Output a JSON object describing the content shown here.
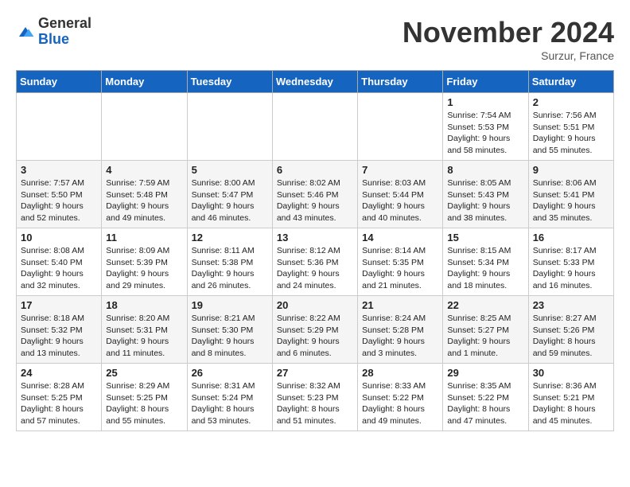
{
  "logo": {
    "general": "General",
    "blue": "Blue"
  },
  "title": "November 2024",
  "subtitle": "Surzur, France",
  "days_of_week": [
    "Sunday",
    "Monday",
    "Tuesday",
    "Wednesday",
    "Thursday",
    "Friday",
    "Saturday"
  ],
  "weeks": [
    [
      {
        "day": "",
        "info": ""
      },
      {
        "day": "",
        "info": ""
      },
      {
        "day": "",
        "info": ""
      },
      {
        "day": "",
        "info": ""
      },
      {
        "day": "",
        "info": ""
      },
      {
        "day": "1",
        "info": "Sunrise: 7:54 AM\nSunset: 5:53 PM\nDaylight: 9 hours and 58 minutes."
      },
      {
        "day": "2",
        "info": "Sunrise: 7:56 AM\nSunset: 5:51 PM\nDaylight: 9 hours and 55 minutes."
      }
    ],
    [
      {
        "day": "3",
        "info": "Sunrise: 7:57 AM\nSunset: 5:50 PM\nDaylight: 9 hours and 52 minutes."
      },
      {
        "day": "4",
        "info": "Sunrise: 7:59 AM\nSunset: 5:48 PM\nDaylight: 9 hours and 49 minutes."
      },
      {
        "day": "5",
        "info": "Sunrise: 8:00 AM\nSunset: 5:47 PM\nDaylight: 9 hours and 46 minutes."
      },
      {
        "day": "6",
        "info": "Sunrise: 8:02 AM\nSunset: 5:46 PM\nDaylight: 9 hours and 43 minutes."
      },
      {
        "day": "7",
        "info": "Sunrise: 8:03 AM\nSunset: 5:44 PM\nDaylight: 9 hours and 40 minutes."
      },
      {
        "day": "8",
        "info": "Sunrise: 8:05 AM\nSunset: 5:43 PM\nDaylight: 9 hours and 38 minutes."
      },
      {
        "day": "9",
        "info": "Sunrise: 8:06 AM\nSunset: 5:41 PM\nDaylight: 9 hours and 35 minutes."
      }
    ],
    [
      {
        "day": "10",
        "info": "Sunrise: 8:08 AM\nSunset: 5:40 PM\nDaylight: 9 hours and 32 minutes."
      },
      {
        "day": "11",
        "info": "Sunrise: 8:09 AM\nSunset: 5:39 PM\nDaylight: 9 hours and 29 minutes."
      },
      {
        "day": "12",
        "info": "Sunrise: 8:11 AM\nSunset: 5:38 PM\nDaylight: 9 hours and 26 minutes."
      },
      {
        "day": "13",
        "info": "Sunrise: 8:12 AM\nSunset: 5:36 PM\nDaylight: 9 hours and 24 minutes."
      },
      {
        "day": "14",
        "info": "Sunrise: 8:14 AM\nSunset: 5:35 PM\nDaylight: 9 hours and 21 minutes."
      },
      {
        "day": "15",
        "info": "Sunrise: 8:15 AM\nSunset: 5:34 PM\nDaylight: 9 hours and 18 minutes."
      },
      {
        "day": "16",
        "info": "Sunrise: 8:17 AM\nSunset: 5:33 PM\nDaylight: 9 hours and 16 minutes."
      }
    ],
    [
      {
        "day": "17",
        "info": "Sunrise: 8:18 AM\nSunset: 5:32 PM\nDaylight: 9 hours and 13 minutes."
      },
      {
        "day": "18",
        "info": "Sunrise: 8:20 AM\nSunset: 5:31 PM\nDaylight: 9 hours and 11 minutes."
      },
      {
        "day": "19",
        "info": "Sunrise: 8:21 AM\nSunset: 5:30 PM\nDaylight: 9 hours and 8 minutes."
      },
      {
        "day": "20",
        "info": "Sunrise: 8:22 AM\nSunset: 5:29 PM\nDaylight: 9 hours and 6 minutes."
      },
      {
        "day": "21",
        "info": "Sunrise: 8:24 AM\nSunset: 5:28 PM\nDaylight: 9 hours and 3 minutes."
      },
      {
        "day": "22",
        "info": "Sunrise: 8:25 AM\nSunset: 5:27 PM\nDaylight: 9 hours and 1 minute."
      },
      {
        "day": "23",
        "info": "Sunrise: 8:27 AM\nSunset: 5:26 PM\nDaylight: 8 hours and 59 minutes."
      }
    ],
    [
      {
        "day": "24",
        "info": "Sunrise: 8:28 AM\nSunset: 5:25 PM\nDaylight: 8 hours and 57 minutes."
      },
      {
        "day": "25",
        "info": "Sunrise: 8:29 AM\nSunset: 5:25 PM\nDaylight: 8 hours and 55 minutes."
      },
      {
        "day": "26",
        "info": "Sunrise: 8:31 AM\nSunset: 5:24 PM\nDaylight: 8 hours and 53 minutes."
      },
      {
        "day": "27",
        "info": "Sunrise: 8:32 AM\nSunset: 5:23 PM\nDaylight: 8 hours and 51 minutes."
      },
      {
        "day": "28",
        "info": "Sunrise: 8:33 AM\nSunset: 5:22 PM\nDaylight: 8 hours and 49 minutes."
      },
      {
        "day": "29",
        "info": "Sunrise: 8:35 AM\nSunset: 5:22 PM\nDaylight: 8 hours and 47 minutes."
      },
      {
        "day": "30",
        "info": "Sunrise: 8:36 AM\nSunset: 5:21 PM\nDaylight: 8 hours and 45 minutes."
      }
    ]
  ]
}
